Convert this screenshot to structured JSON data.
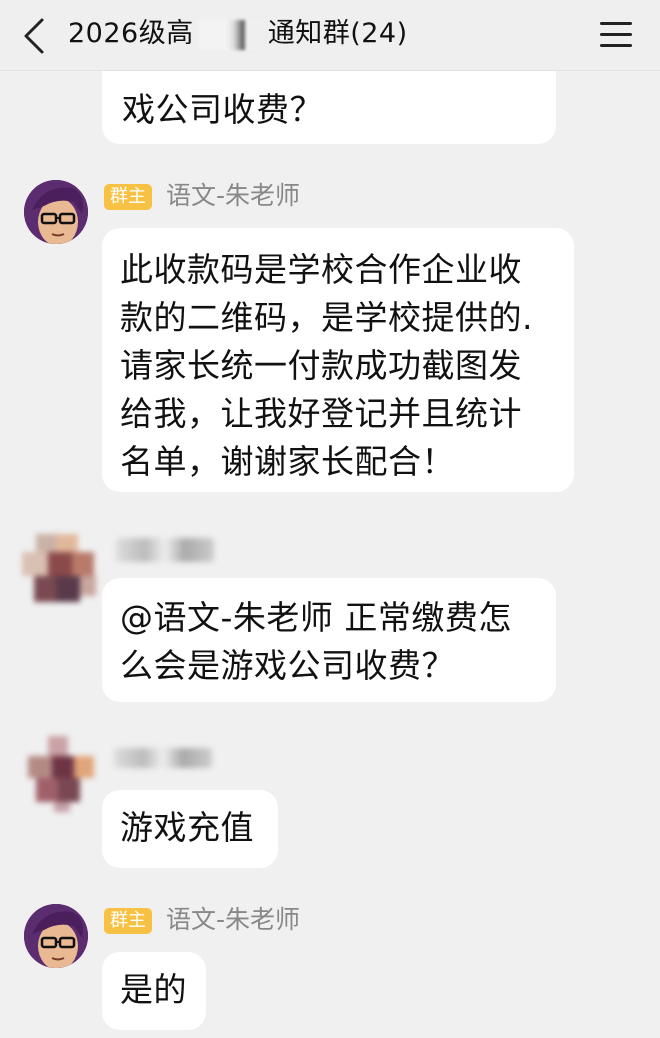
{
  "header": {
    "title_start": "2026级高",
    "title_end": "通知群(24)"
  },
  "messages": [
    {
      "text": "戏公司收费？"
    },
    {
      "badge": "群主",
      "sender": "语文-朱老师",
      "text_lines": [
        "此收款码是学校合作企业收",
        "款的二维码，是学校提供的.",
        "请家长统一付款成功截图发",
        "给我，让我好登记并且统计",
        "名单，谢谢家长配合！"
      ]
    },
    {
      "text_lines": [
        "@语文-朱老师 正常缴费怎",
        "么会是游戏公司收费？"
      ]
    },
    {
      "text": "游戏充值"
    },
    {
      "badge": "群主",
      "sender": "语文-朱老师",
      "text": "是的"
    }
  ]
}
